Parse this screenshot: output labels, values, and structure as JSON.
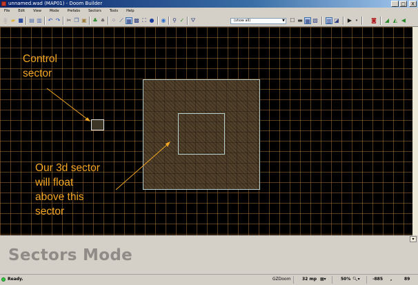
{
  "window": {
    "title": "unnamed.wad (MAP01) - Doom Builder",
    "buttons": [
      "_",
      "□",
      "X"
    ]
  },
  "menu": [
    "File",
    "Edit",
    "View",
    "Mode",
    "Prefabs",
    "Sectors",
    "Tools",
    "Help"
  ],
  "toolbar": {
    "filter_value": "(show all)",
    "icons": [
      "new-map-icon",
      "open-map-icon",
      "save-map-icon",
      "map-options-icon",
      "script-editor-icon",
      "undo-icon",
      "redo-icon",
      "cut-icon",
      "copy-icon",
      "paste-icon",
      "insert-prefab-icon",
      "insert-previous-prefab-icon",
      "vertices-mode-icon",
      "linedefs-mode-icon",
      "sectors-mode-icon",
      "things-mode-icon",
      "make-sectors-icon",
      "visual-mode-icon",
      "find-icon",
      "error-check-icon",
      "filter-icon",
      "toggle-comments-icon",
      "toggle-grid-icon",
      "toggle-lights-icon",
      "toggle-models-icon",
      "fullbright-icon",
      "test-map-icon",
      "doom-logo-icon",
      "sector-tools-icon",
      "gradient-icon",
      "align-icon"
    ]
  },
  "annotations": {
    "control": "Control\nsector",
    "floor": "Our 3d sector\nwill float\nabove this\nsector"
  },
  "info_panel": {
    "mode_title": "Sectors Mode",
    "expand_glyph": "▾"
  },
  "status": {
    "text": "Ready.",
    "engine": "GZDoom",
    "grid": "32 mp",
    "zoom": "50%",
    "coord_x": "-885",
    "coord_sep": ",",
    "coord_y": "89"
  },
  "colors": {
    "annotation": "#f5a623",
    "grid_line": "#a06e32",
    "sector_line": "#b9d4d0",
    "title_bar": "#0a246a"
  }
}
